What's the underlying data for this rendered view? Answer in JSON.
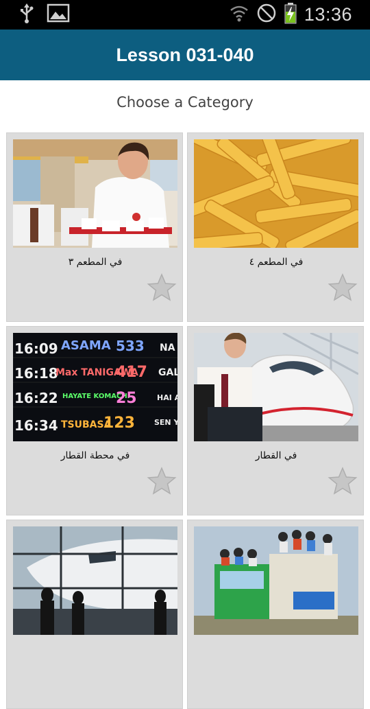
{
  "status_bar": {
    "time": "13:36",
    "left_icons": [
      "usb-icon",
      "image-icon"
    ],
    "right_icons": [
      "wifi-icon",
      "blocked-icon",
      "battery-charging-icon"
    ]
  },
  "app_bar": {
    "title": "Lesson 031-040"
  },
  "page": {
    "subtitle": "Choose a Category"
  },
  "categories": [
    {
      "label": "في المطعم ٣",
      "image": "waiter-restaurant-photo",
      "favorite": false
    },
    {
      "label": "في المطعم ٤",
      "image": "french-fries-photo",
      "favorite": false
    },
    {
      "label": "في محطة القطار",
      "image": "train-departure-board-photo",
      "favorite": false
    },
    {
      "label": "في القطار",
      "image": "man-at-train-photo",
      "favorite": false
    },
    {
      "label": "",
      "image": "airport-airplane-photo",
      "favorite": false
    },
    {
      "label": "",
      "image": "crowded-truck-photo",
      "favorite": false
    }
  ],
  "departure_board": {
    "rows": [
      {
        "time": "16:09",
        "name": "ASAMA",
        "number": "533"
      },
      {
        "time": "16:18",
        "name": "Max TANIGAWA",
        "number": "417"
      },
      {
        "time": "16:22",
        "name": "HAYATE KOMACHI",
        "number": "25"
      },
      {
        "time": "16:34",
        "name": "TSUBASA",
        "number": "123"
      }
    ],
    "right_column": [
      "NA",
      "GAL",
      "HAI AKI",
      "SEN YAMA"
    ]
  },
  "colors": {
    "app_bar": "#0d5e80",
    "card_bg": "#dcdcdc",
    "status_bar": "#000000"
  }
}
